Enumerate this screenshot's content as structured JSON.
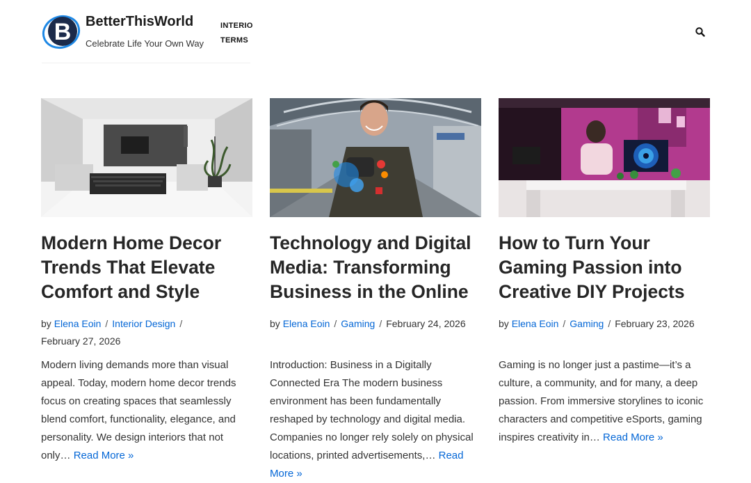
{
  "site": {
    "name": "BetterThisWorld",
    "tagline": "Celebrate Life Your Own Way",
    "logo_letter": "B"
  },
  "nav": {
    "items": [
      {
        "label": "INTERIOR"
      },
      {
        "label": "TERMS"
      }
    ]
  },
  "header": {
    "search_icon": "search-icon"
  },
  "posts": [
    {
      "title": "Modern Home Decor Trends That Elevate Comfort and Style",
      "by": "by",
      "author": "Elena Eoin",
      "category": "Interior Design",
      "date": "February 27, 2026",
      "excerpt": "Modern living demands more than visual appeal. Today, modern home decor trends focus on creating spaces that seamlessly blend comfort, functionality, elegance, and personality. We design interiors that not only… ",
      "read_more": "Read More »",
      "image": "living-room-image"
    },
    {
      "title": "Technology and Digital Media: Transforming Business in the Online",
      "by": "by",
      "author": "Elena Eoin",
      "category": "Gaming",
      "date": "February 24, 2026",
      "excerpt": "Introduction: Business in a Digitally Connected Era The modern business environment has been fundamentally reshaped by technology and digital media. Companies no longer rely solely on physical locations, printed advertisements,… ",
      "read_more": "Read More »",
      "image": "man-with-phone-image"
    },
    {
      "title": "How to Turn Your Gaming Passion into Creative DIY Projects",
      "by": "by",
      "author": "Elena Eoin",
      "category": "Gaming",
      "date": "February 23, 2026",
      "excerpt": "Gaming is no longer just a pastime—it’s a culture, a community, and for many, a deep passion. From immersive storylines to iconic characters and competitive eSports, gaming inspires creativity in… ",
      "read_more": "Read More »",
      "image": "gaming-room-image"
    }
  ],
  "colors": {
    "link": "#0366d6",
    "logo_dark": "#1b2a4a",
    "logo_accent": "#1e88e5"
  }
}
